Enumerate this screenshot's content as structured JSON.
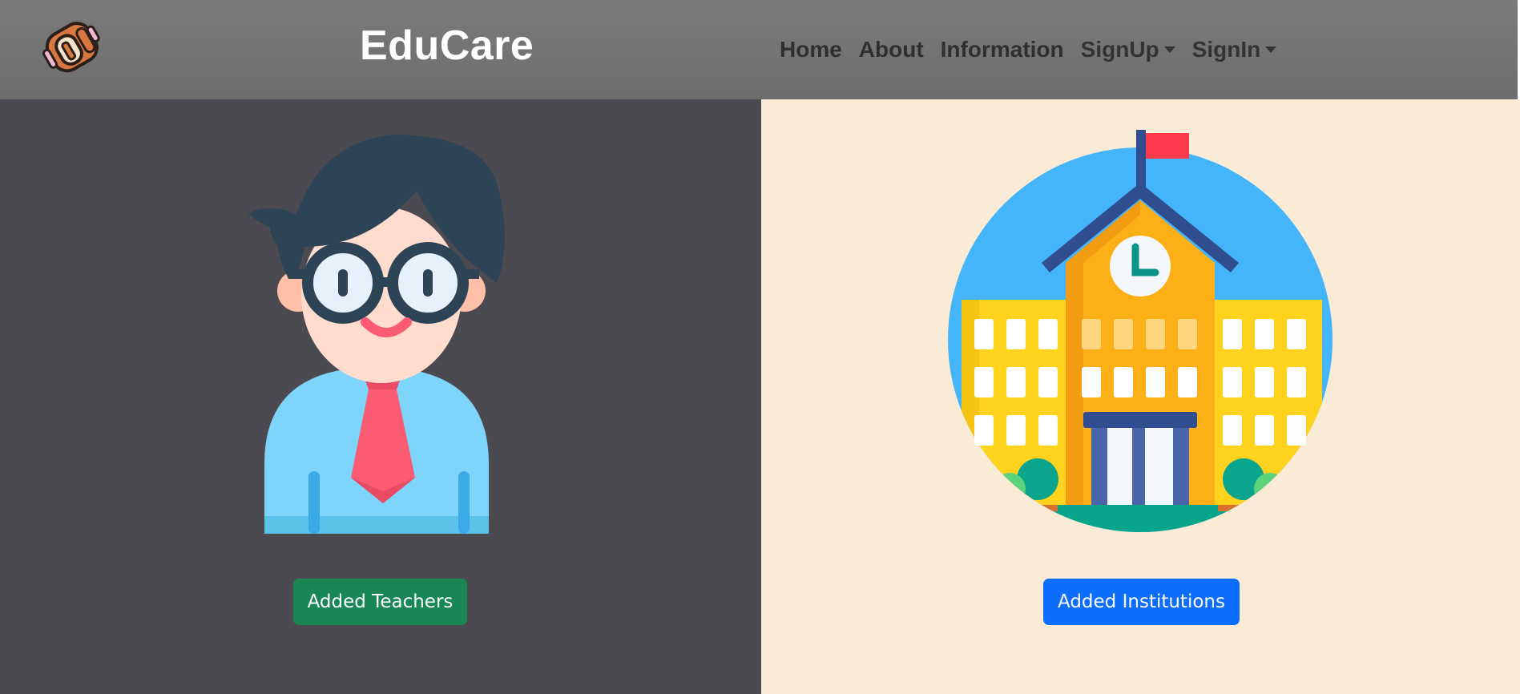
{
  "header": {
    "brand": "EduCare",
    "logo_icon": "backpack-icon",
    "nav": {
      "home": "Home",
      "about": "About",
      "information": "Information",
      "signup": "SignUp",
      "signin": "SignIn"
    }
  },
  "panels": {
    "teachers": {
      "illustration_icon": "teacher-avatar-icon",
      "button_label": "Added Teachers",
      "background": "#4b4a50",
      "button_color": "#198754"
    },
    "institutions": {
      "illustration_icon": "school-building-icon",
      "button_label": "Added Institutions",
      "background": "#faebd7",
      "button_color": "#0d6efd"
    }
  },
  "colors": {
    "navbar": "#737373",
    "brand_text": "#ffffff",
    "nav_text": "#2f2f2f"
  }
}
